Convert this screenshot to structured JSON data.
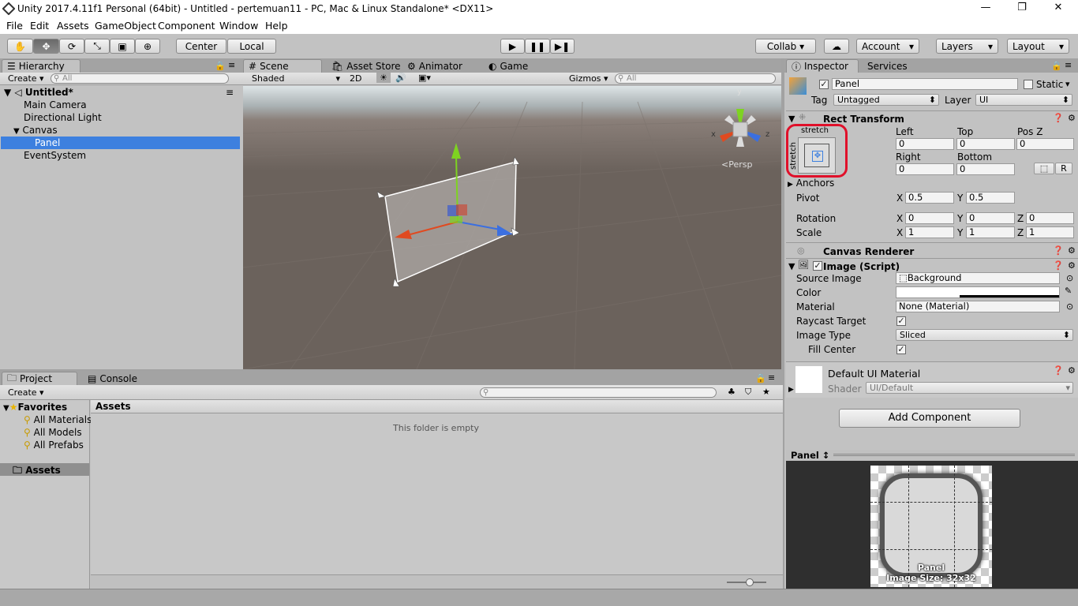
{
  "window": {
    "title": "Unity 2017.4.11f1 Personal (64bit) - Untitled - pertemuan11 - PC, Mac & Linux Standalone* <DX11>",
    "min": "—",
    "max": "❐",
    "close": "✕"
  },
  "menu": [
    "File",
    "Edit",
    "Assets",
    "GameObject",
    "Component",
    "Window",
    "Help"
  ],
  "toolbar": {
    "pivot": "Center",
    "space": "Local",
    "collab": "Collab ▾",
    "account": "Account",
    "layers": "Layers",
    "layout": "Layout"
  },
  "hierarchy": {
    "tab": "Hierarchy",
    "create": "Create ▾",
    "search": "All",
    "scene": "Untitled*",
    "items": [
      "Main Camera",
      "Directional Light",
      "Canvas",
      "Panel",
      "EventSystem"
    ]
  },
  "scene": {
    "tabs": [
      "Scene",
      "Asset Store",
      "Animator",
      "Game"
    ],
    "shading": "Shaded",
    "mode2d": "2D",
    "gizmos": "Gizmos",
    "search": "All",
    "persp": "Persp",
    "axes": {
      "x": "x",
      "y": "y",
      "z": "z"
    }
  },
  "project": {
    "tabs": [
      "Project",
      "Console"
    ],
    "create": "Create ▾",
    "favorites_label": "Favorites",
    "favorites": [
      "All Materials",
      "All Models",
      "All Prefabs"
    ],
    "assets_label": "Assets",
    "breadcrumb": "Assets",
    "empty": "This folder is empty"
  },
  "inspector": {
    "tabs": [
      "Inspector",
      "Services"
    ],
    "name": "Panel",
    "static": "Static",
    "tag_label": "Tag",
    "tag": "Untagged",
    "layer_label": "Layer",
    "layer": "UI",
    "rect": {
      "title": "Rect Transform",
      "stretch_h": "stretch",
      "stretch_v": "stretch",
      "left_label": "Left",
      "top_label": "Top",
      "posz_label": "Pos Z",
      "left": "0",
      "top": "0",
      "posz": "0",
      "right_label": "Right",
      "bottom_label": "Bottom",
      "right": "0",
      "bottom": "0",
      "r_button": "R",
      "anchors": "Anchors",
      "pivot_label": "Pivot",
      "pivot_x": "0.5",
      "pivot_y": "0.5",
      "rotation_label": "Rotation",
      "rot_x": "0",
      "rot_y": "0",
      "rot_z": "0",
      "scale_label": "Scale",
      "scale_x": "1",
      "scale_y": "1",
      "scale_z": "1",
      "x": "X",
      "y": "Y",
      "z": "Z"
    },
    "canvas_renderer": "Canvas Renderer",
    "image": {
      "title": "Image (Script)",
      "source_label": "Source Image",
      "source": "Background",
      "color_label": "Color",
      "material_label": "Material",
      "material": "None (Material)",
      "raycast_label": "Raycast Target",
      "type_label": "Image Type",
      "type": "Sliced",
      "fill_label": "Fill Center"
    },
    "material": {
      "title": "Default UI Material",
      "shader_label": "Shader",
      "shader": "UI/Default"
    },
    "add_component": "Add Component",
    "preview": {
      "title": "Panel ↕",
      "caption": "Panel",
      "size": "Image Size: 32x32"
    }
  },
  "colors": {
    "highlight": "#3d80df",
    "red_circle": "#e0102a",
    "scene_bg": "#6b625c"
  }
}
